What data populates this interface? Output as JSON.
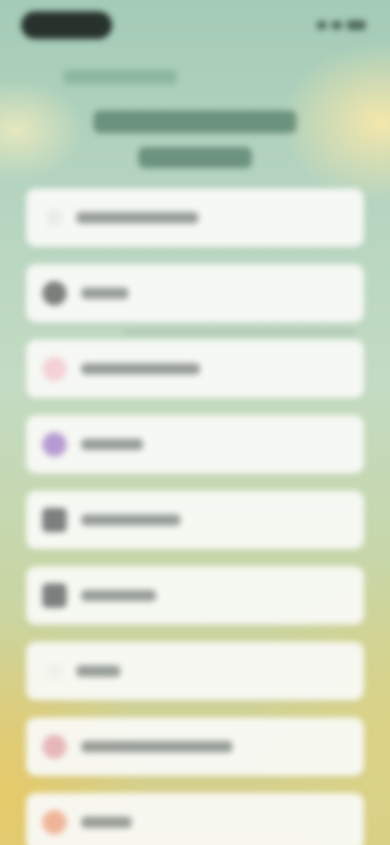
{
  "colors": {
    "background_top": "#a3cbb7",
    "background_bottom": "#d9cf86",
    "card": "#f9faf6",
    "status_pill": "#27322c"
  },
  "list": {
    "items": [
      {
        "icon": "chevron-icon",
        "icon_color": "#e8ece6",
        "label_width": 150
      },
      {
        "icon": "gray-circle-icon",
        "icon_color": "#7a7f7c",
        "label_width": 58
      },
      {
        "icon": "heart-icon",
        "icon_color": "#f3d1d6",
        "label_width": 146
      },
      {
        "icon": "purple-circle-icon",
        "icon_color": "#b79ad3",
        "label_width": 76
      },
      {
        "icon": "gray-square-icon",
        "icon_color": "#7c7f7e",
        "label_width": 122
      },
      {
        "icon": "gray-square-icon",
        "icon_color": "#7c7f7e",
        "label_width": 92
      },
      {
        "icon": "blank-icon",
        "icon_color": "#eef0ea",
        "label_width": 54
      },
      {
        "icon": "pink-circle-icon",
        "icon_color": "#e6b7b9",
        "label_width": 186
      },
      {
        "icon": "orange-circle-icon",
        "icon_color": "#f0b49a",
        "label_width": 62
      }
    ]
  }
}
